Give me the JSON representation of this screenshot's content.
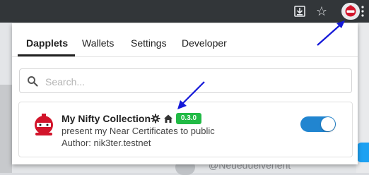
{
  "tabs": [
    {
      "label": "Dapplets",
      "active": true
    },
    {
      "label": "Wallets",
      "active": false
    },
    {
      "label": "Settings",
      "active": false
    },
    {
      "label": "Developer",
      "active": false
    }
  ],
  "search": {
    "placeholder": "Search..."
  },
  "dapplet": {
    "title": "My Nifty Collection",
    "version": "0.3.0",
    "description": "present my Near Certificates to public",
    "author": "Author: nik3ter.testnet",
    "enabled": true
  },
  "page": {
    "partial_text": "@Neueduelvenent"
  },
  "colors": {
    "accent": "#2185d0",
    "version_badge": "#21ba45",
    "logo_red": "#d2142a",
    "annotation_arrow": "#1418d8"
  },
  "icons": [
    "download-icon",
    "star-icon",
    "dapplet-extension-icon",
    "search-icon",
    "settings-gear-icon",
    "home-icon"
  ]
}
